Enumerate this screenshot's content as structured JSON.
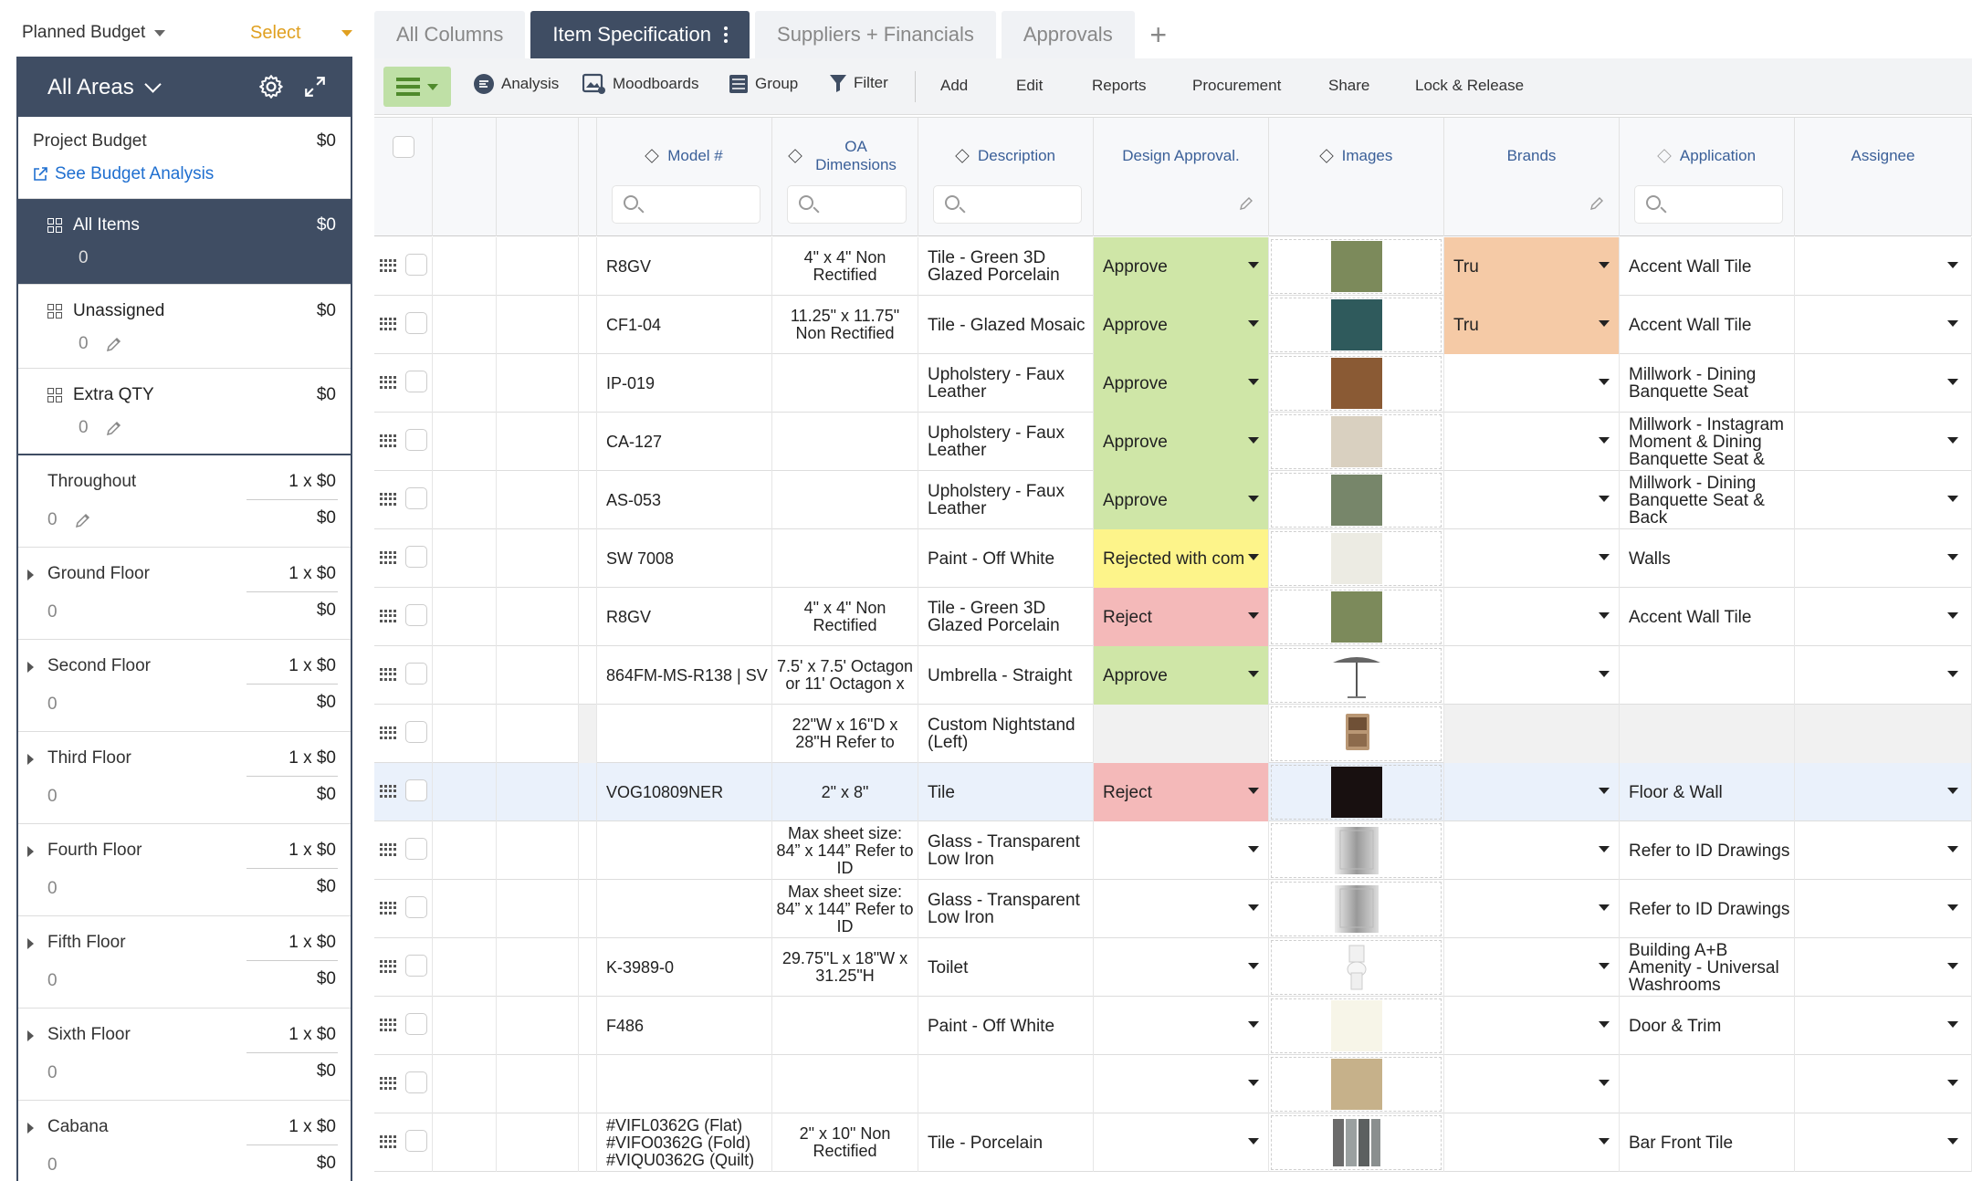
{
  "sidebar": {
    "budget_selector": "Planned Budget",
    "select_label": "Select",
    "area_title": "All Areas",
    "project_budget": {
      "label": "Project Budget",
      "value": "$0",
      "link": "See Budget Analysis"
    },
    "groups": [
      {
        "label": "All Items",
        "value": "$0",
        "count": "0"
      },
      {
        "label": "Unassigned",
        "value": "$0",
        "count": "0"
      },
      {
        "label": "Extra QTY",
        "value": "$0",
        "count": "0"
      }
    ],
    "floors": [
      {
        "name": "Throughout",
        "qty": "1 x $0",
        "count": "0",
        "total": "$0"
      },
      {
        "name": "Ground Floor",
        "qty": "1 x $0",
        "count": "0",
        "total": "$0"
      },
      {
        "name": "Second Floor",
        "qty": "1 x $0",
        "count": "0",
        "total": "$0"
      },
      {
        "name": "Third Floor",
        "qty": "1 x $0",
        "count": "0",
        "total": "$0"
      },
      {
        "name": "Fourth Floor",
        "qty": "1 x $0",
        "count": "0",
        "total": "$0"
      },
      {
        "name": "Fifth Floor",
        "qty": "1 x $0",
        "count": "0",
        "total": "$0"
      },
      {
        "name": "Sixth Floor",
        "qty": "1 x $0",
        "count": "0",
        "total": "$0"
      },
      {
        "name": "Cabana",
        "qty": "1 x $0",
        "count": "0",
        "total": "$0"
      }
    ]
  },
  "tabs": [
    "All Columns",
    "Item Specification",
    "Suppliers + Financials",
    "Approvals"
  ],
  "toolbar": {
    "analysis": "Analysis",
    "moodboards": "Moodboards",
    "group": "Group",
    "filter": "Filter",
    "add": "Add",
    "edit": "Edit",
    "reports": "Reports",
    "procurement": "Procurement",
    "share": "Share",
    "lock_release": "Lock & Release"
  },
  "columns": {
    "model": "Model #",
    "oa_dimensions": "OA Dimensions",
    "description": "Description",
    "design_approval": "Design Approval.",
    "images": "Images",
    "brands": "Brands",
    "application": "Application",
    "assignee": "Assignee"
  },
  "rows": [
    {
      "model": "R8GV",
      "dims": "4\" x 4\" Non Rectified",
      "desc": "Tile - Green 3D Glazed Porcelain",
      "approval": "Approve",
      "approval_color": "green",
      "img": "#7c8a5b",
      "brand": "Tru",
      "app": "Accent Wall Tile"
    },
    {
      "model": "CF1-04",
      "dims": "11.25\" x 11.75\" Non Rectified",
      "desc": "Tile - Glazed Mosaic",
      "approval": "Approve",
      "approval_color": "green",
      "img": "#2f5a5c",
      "brand": "Tru",
      "app": "Accent Wall Tile"
    },
    {
      "model": "IP-019",
      "dims": "",
      "desc": "Upholstery - Faux Leather",
      "approval": "Approve",
      "approval_color": "green",
      "img": "#8a5a34",
      "brand": "",
      "app": "Millwork - Dining Banquette Seat"
    },
    {
      "model": "CA-127",
      "dims": "",
      "desc": "Upholstery - Faux Leather",
      "approval": "Approve",
      "approval_color": "green",
      "img": "#d9d0c0",
      "brand": "",
      "app": "Millwork - Instagram Moment & Dining Banquette Seat &"
    },
    {
      "model": "AS-053",
      "dims": "",
      "desc": "Upholstery - Faux Leather",
      "approval": "Approve",
      "approval_color": "green",
      "img": "#77866a",
      "brand": "",
      "app": "Millwork - Dining Banquette Seat & Back"
    },
    {
      "model": "SW 7008",
      "dims": "",
      "desc": "Paint - Off White",
      "approval": "Rejected with com",
      "approval_color": "yellow",
      "img": "#ecebe3",
      "brand": "",
      "app": "Walls"
    },
    {
      "model": "R8GV",
      "dims": "4\" x 4\" Non Rectified",
      "desc": "Tile - Green 3D Glazed Porcelain",
      "approval": "Reject",
      "approval_color": "red",
      "img": "#7c8a5b",
      "brand": "",
      "app": "Accent Wall Tile"
    },
    {
      "model": "864FM-MS-R138 | SV",
      "dims": "7.5' x 7.5' Octagon or 11' Octagon x",
      "desc": "Umbrella - Straight",
      "approval": "Approve",
      "approval_color": "green",
      "img": "umbrella",
      "brand": "",
      "app": ""
    },
    {
      "model": "",
      "dims": "22\"W x 16\"D x 28\"H Refer to",
      "desc": "Custom Nightstand (Left)",
      "approval": "",
      "approval_color": "gray",
      "img": "nightstand",
      "brand": "",
      "app": ""
    },
    {
      "model": "VOG10809NER",
      "dims": "2\" x 8\"",
      "desc": "Tile",
      "approval": "Reject",
      "approval_color": "red",
      "img": "#181010",
      "brand": "",
      "app": "Floor & Wall"
    },
    {
      "model": "",
      "dims": "Max sheet size: 84” x 144” Refer to ID",
      "desc": "Glass - Transparent Low Iron",
      "approval": "",
      "approval_color": "none",
      "img": "glass",
      "brand": "",
      "app": "Refer to ID Drawings"
    },
    {
      "model": "",
      "dims": "Max sheet size: 84” x 144” Refer to ID",
      "desc": "Glass - Transparent Low Iron",
      "approval": "",
      "approval_color": "none",
      "img": "glass",
      "brand": "",
      "app": "Refer to ID Drawings"
    },
    {
      "model": "K-3989-0",
      "dims": "29.75\"L x 18\"W x 31.25\"H",
      "desc": "Toilet",
      "approval": "",
      "approval_color": "none",
      "img": "toilet",
      "brand": "",
      "app": "Building A+B Amenity - Universal Washrooms"
    },
    {
      "model": "F486",
      "dims": "",
      "desc": "Paint - Off White",
      "approval": "",
      "approval_color": "none",
      "img": "#f7f5e8",
      "brand": "",
      "app": "Door & Trim"
    },
    {
      "model": "",
      "dims": "",
      "desc": "",
      "approval": "",
      "approval_color": "none",
      "img": "#c6b18a",
      "brand": "",
      "app": ""
    },
    {
      "model": "#VIFL0362G (Flat) #VIFO0362G (Fold) #VIQU0362G (Quilt)",
      "dims": "2\" x 10\" Non Rectified",
      "desc": "Tile - Porcelain",
      "approval": "",
      "approval_color": "none",
      "img": "strips",
      "brand": "",
      "app": "Bar Front Tile"
    }
  ]
}
